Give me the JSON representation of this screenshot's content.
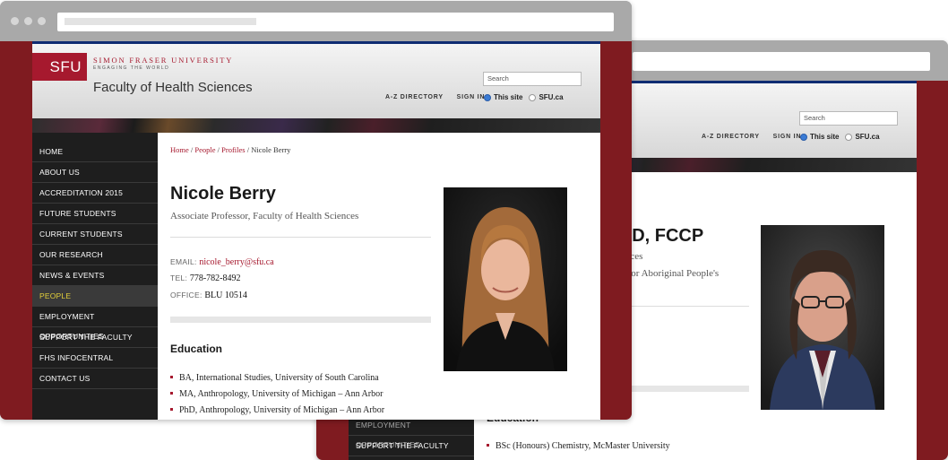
{
  "colors": {
    "sfu_red": "#a6192e",
    "frame_maroon": "#7f1b20",
    "nav_dark": "#1e1e1e",
    "active_nav_text": "#e2cf3a",
    "top_rule": "#0f2c72"
  },
  "header": {
    "logo_text": "SFU",
    "university_name": "SIMON FRASER UNIVERSITY",
    "tagline": "ENGAGING THE WORLD",
    "faculty": "Faculty of Health Sciences",
    "search_placeholder": "Search",
    "links": {
      "directory": "A-Z DIRECTORY",
      "sign_in": "SIGN IN"
    },
    "scope_options": {
      "this_site": "This site",
      "sfu": "SFU.ca"
    },
    "selected_scope": "This site"
  },
  "sidebar": {
    "items": [
      {
        "label": "HOME"
      },
      {
        "label": "ABOUT US"
      },
      {
        "label": "ACCREDITATION 2015"
      },
      {
        "label": "FUTURE STUDENTS"
      },
      {
        "label": "CURRENT STUDENTS"
      },
      {
        "label": "OUR RESEARCH"
      },
      {
        "label": "NEWS & EVENTS"
      },
      {
        "label": "PEOPLE"
      },
      {
        "label": "EMPLOYMENT OPPORTUNITIES"
      },
      {
        "label": "SUPPORT THE FACULTY"
      },
      {
        "label": "FHS INFOCENTRAL"
      },
      {
        "label": "CONTACT US"
      }
    ],
    "active": "PEOPLE"
  },
  "front": {
    "breadcrumb": {
      "home": "Home",
      "people": "People",
      "profiles": "Profiles",
      "current": "Nicole Berry"
    },
    "name": "Nicole Berry",
    "position": "Associate Professor, Faculty of Health Sciences",
    "contact": {
      "email_label": "EMAIL:",
      "email": "nicole_berry@sfu.ca",
      "tel_label": "TEL:",
      "tel": "778-782-8492",
      "office_label": "OFFICE:",
      "office": "BLU 10514"
    },
    "education_heading": "Education",
    "education": [
      "BA, International Studies, University of South Carolina",
      "MA, Anthropology, University of Michigan – Ann Arbor",
      "PhD, Anthropology, University of Michigan – Ann Arbor"
    ]
  },
  "back": {
    "name_fragment": "nD, FCCP",
    "position_fragment": "ences",
    "role_fragment": "e for Aboriginal People's",
    "sidebar_visible": [
      "EMPLOYMENT OPPORTUNITIES",
      "SUPPORT THE FACULTY"
    ],
    "education_heading": "Education",
    "education": [
      "BSc (Honours) Chemistry, McMaster University"
    ]
  }
}
